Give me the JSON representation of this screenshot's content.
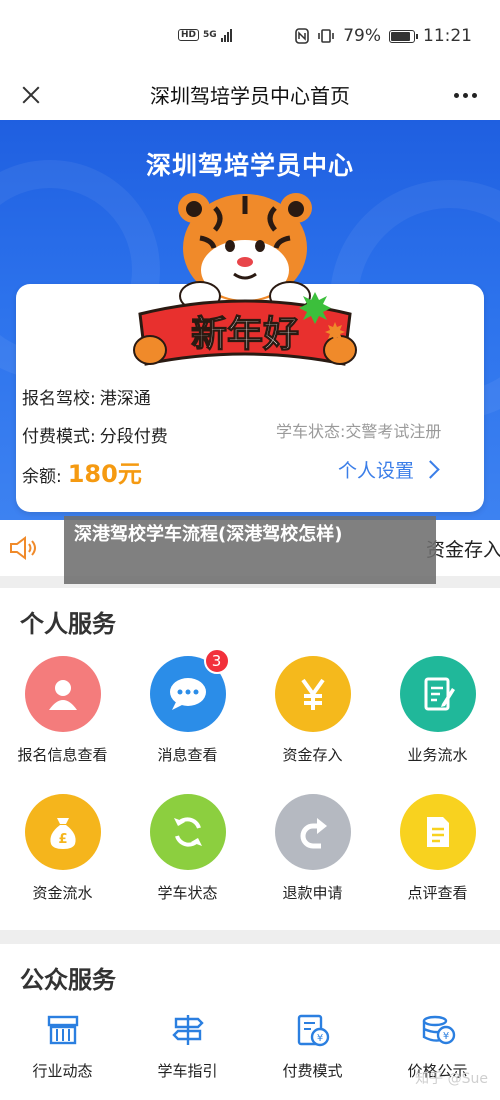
{
  "status_bar": {
    "network": "HD",
    "signal_label": "5G",
    "battery_percent": "79%",
    "time": "11:21"
  },
  "header": {
    "title": "深圳驾培学员中心首页"
  },
  "hero": {
    "title": "深圳驾培学员中心",
    "greeting_banner": "新年好"
  },
  "info": {
    "school_label": "报名驾校:",
    "school_value": "港深通",
    "pay_mode_label": "付费模式:",
    "pay_mode_value": "分段付费",
    "balance_label": "余额:",
    "balance_value": "180元",
    "study_status": "学车状态:交警考试注册",
    "settings_label": "个人设置"
  },
  "notice": {
    "text": "资金存入"
  },
  "overlay_caption": "深港驾校学车流程(深港驾校怎样)",
  "personal_services": {
    "title": "个人服务",
    "items": [
      {
        "label": "报名信息查看",
        "color": "#f47c7c",
        "icon": "user-icon"
      },
      {
        "label": "消息查看",
        "color": "#2b8de8",
        "icon": "chat-icon",
        "badge": "3"
      },
      {
        "label": "资金存入",
        "color": "#f5b91c",
        "icon": "yen-icon"
      },
      {
        "label": "业务流水",
        "color": "#20b89a",
        "icon": "document-edit-icon"
      },
      {
        "label": "资金流水",
        "color": "#f5b51c",
        "icon": "money-bag-icon"
      },
      {
        "label": "学车状态",
        "color": "#8ccf3f",
        "icon": "refresh-icon"
      },
      {
        "label": "退款申请",
        "color": "#b5b9c1",
        "icon": "return-arrow-icon"
      },
      {
        "label": "点评查看",
        "color": "#f8d21f",
        "icon": "review-doc-icon"
      }
    ]
  },
  "public_services": {
    "title": "公众服务",
    "items": [
      {
        "label": "行业动态",
        "icon": "news-icon"
      },
      {
        "label": "学车指引",
        "icon": "signpost-icon"
      },
      {
        "label": "付费模式",
        "icon": "payment-doc-icon"
      },
      {
        "label": "价格公示",
        "icon": "price-coins-icon"
      }
    ]
  },
  "watermark": "知乎 @Sue",
  "colors": {
    "primary": "#2c72ec",
    "accent_orange": "#f59a11",
    "link_blue": "#3b7ee8",
    "badge_red": "#f2303b"
  }
}
